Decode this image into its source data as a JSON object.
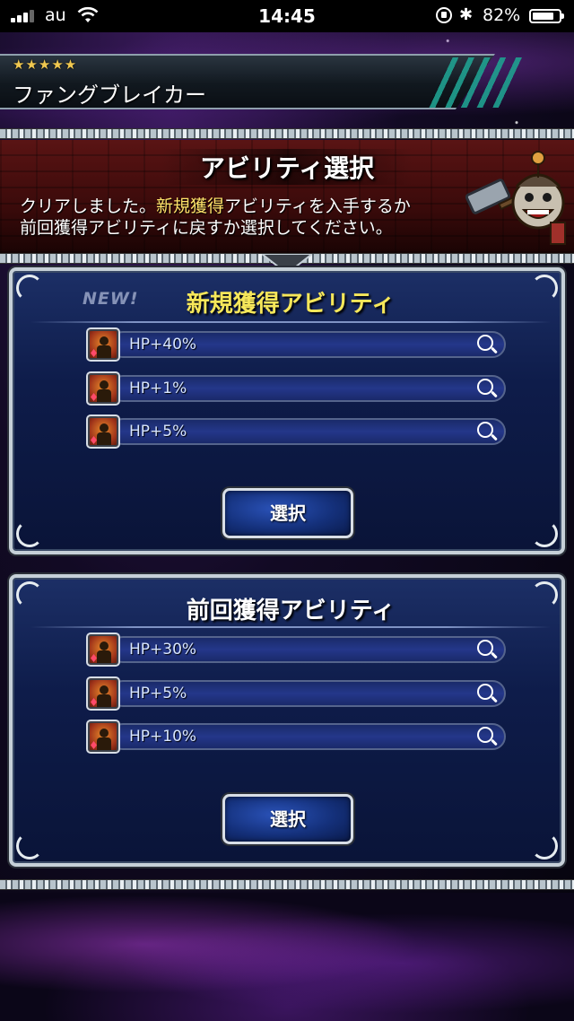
{
  "status_bar": {
    "carrier": "au",
    "time": "14:45",
    "battery_percent": "82%",
    "battery_level": 0.82,
    "bluetooth_icon": "bluetooth-icon",
    "wifi_icon": "wifi-icon"
  },
  "unit": {
    "stars": "★★★★★",
    "name": "ファングブレイカー"
  },
  "header": {
    "title": "アビリティ選択",
    "message_line1_pre": "クリアしました。",
    "message_line1_highlight": "新規獲得",
    "message_line1_post": "アビリティを入手するか",
    "message_line2": "前回獲得アビリティに戻すか選択してください。"
  },
  "new_panel": {
    "badge": "NEW!",
    "title": "新規獲得アビリティ",
    "abilities": [
      {
        "label": "HP+40%"
      },
      {
        "label": "HP+1%"
      },
      {
        "label": "HP+5%"
      }
    ],
    "select_label": "選択"
  },
  "previous_panel": {
    "title": "前回獲得アビリティ",
    "abilities": [
      {
        "label": "HP+30%"
      },
      {
        "label": "HP+5%"
      },
      {
        "label": "HP+10%"
      }
    ],
    "select_label": "選択"
  },
  "colors": {
    "highlight": "#ffe36a",
    "new_title": "#f6e75a",
    "star": "#f0c850"
  }
}
